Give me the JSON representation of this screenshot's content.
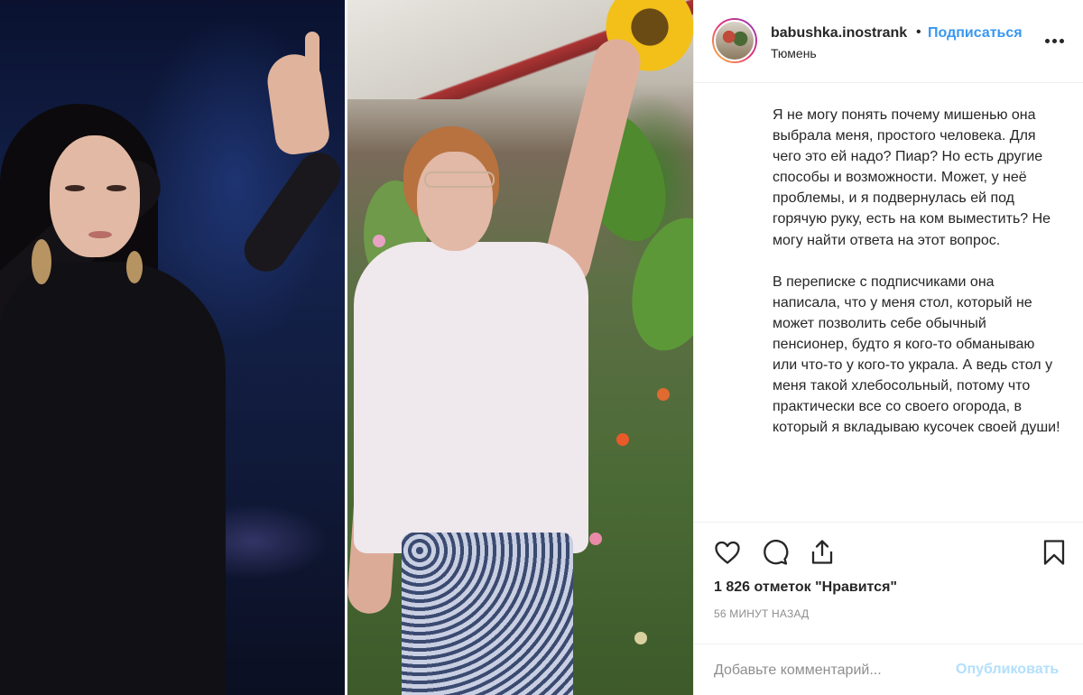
{
  "post": {
    "username": "babushka.inostrank",
    "separator": "•",
    "follow_label": "Подписаться",
    "location": "Тюмень",
    "caption_paragraphs": [
      "Я не могу понять почему мишенью она выбрала меня, простого человека. Для чего это ей надо? Пиар? Но есть другие способы и возможности. Может, у неё проблемы, и я подвернулась ей под горячую руку, есть на ком выместить? Не могу найти ответа на этот вопрос.",
      "В переписке с подписчиками она написала, что у меня стол, который не может позволить себе обычный пенсионер, будто я кого-то обманываю или что-то у кого-то украла. А ведь стол у меня такой хлебосольный, потому что практически все со своего огорода, в который я вкладываю кусочек своей души!"
    ],
    "likes": "1 826 отметок \"Нравится\"",
    "time_ago": "56 МИНУТ НАЗАД"
  },
  "comment": {
    "placeholder": "Добавьте комментарий...",
    "publish_label": "Опубликовать"
  },
  "icons": {
    "like": "heart-icon",
    "comment": "comment-bubble-icon",
    "share": "share-icon",
    "save": "bookmark-icon",
    "more": "more-horizontal-icon"
  },
  "colors": {
    "accent": "#3897f0",
    "publish_disabled": "#b2dffc",
    "text": "#262626",
    "muted": "#8e8e8e",
    "border": "#efefef"
  }
}
